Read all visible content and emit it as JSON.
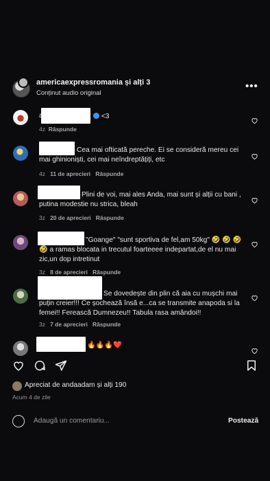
{
  "header": {
    "title": "americaexpressromania și alți 3",
    "audio": "Conținut audio original"
  },
  "comments": [
    {
      "text": "<3",
      "age": "4z",
      "likes": "",
      "reply": "Răspunde"
    },
    {
      "text": "Cea mai ofticată pereche. Ei se consideră mereu cei mai ghinioniști, cei mai neîndreptățiți, etc",
      "age": "4z",
      "likes": "11 de aprecieri",
      "reply": "Răspunde"
    },
    {
      "text": "Plini de voi, mai ales Anda, mai sunt și alții cu bani , putina modestie nu strica, bleah",
      "age": "3z",
      "likes": "20 de aprecieri",
      "reply": "Răspunde"
    },
    {
      "text": "\"Goange\" \"sunt sportiva de fel,am 50kg\" 🤣 🤣 🤣 🤣 a ramas blocata in trecutul foarteeee indepartat,de el nu mai zic,un dop intretinut",
      "age": "3z",
      "likes": "8 de aprecieri",
      "reply": "Răspunde"
    },
    {
      "text": "Se dovedește din plin că aia cu mușchi mai puțin creier!!! Ce șochează însă e...ca se transmite anapoda si la femei!! Ferească Dumnezeu!! Tabula rasa amândoi!!",
      "age": "3z",
      "likes": "7 de aprecieri",
      "reply": "Răspunde"
    },
    {
      "text": "🔥🔥🔥❤️"
    }
  ],
  "actions": {
    "liked_by": "Apreciat de andaadam și alți 190",
    "time": "Acum 4 de zile"
  },
  "composer": {
    "placeholder": "Adaugă un comentariu...",
    "post": "Postează"
  },
  "colors": {
    "background": "#0b0b0d",
    "verified": "#3897f0",
    "redaction": "#ffffff"
  }
}
